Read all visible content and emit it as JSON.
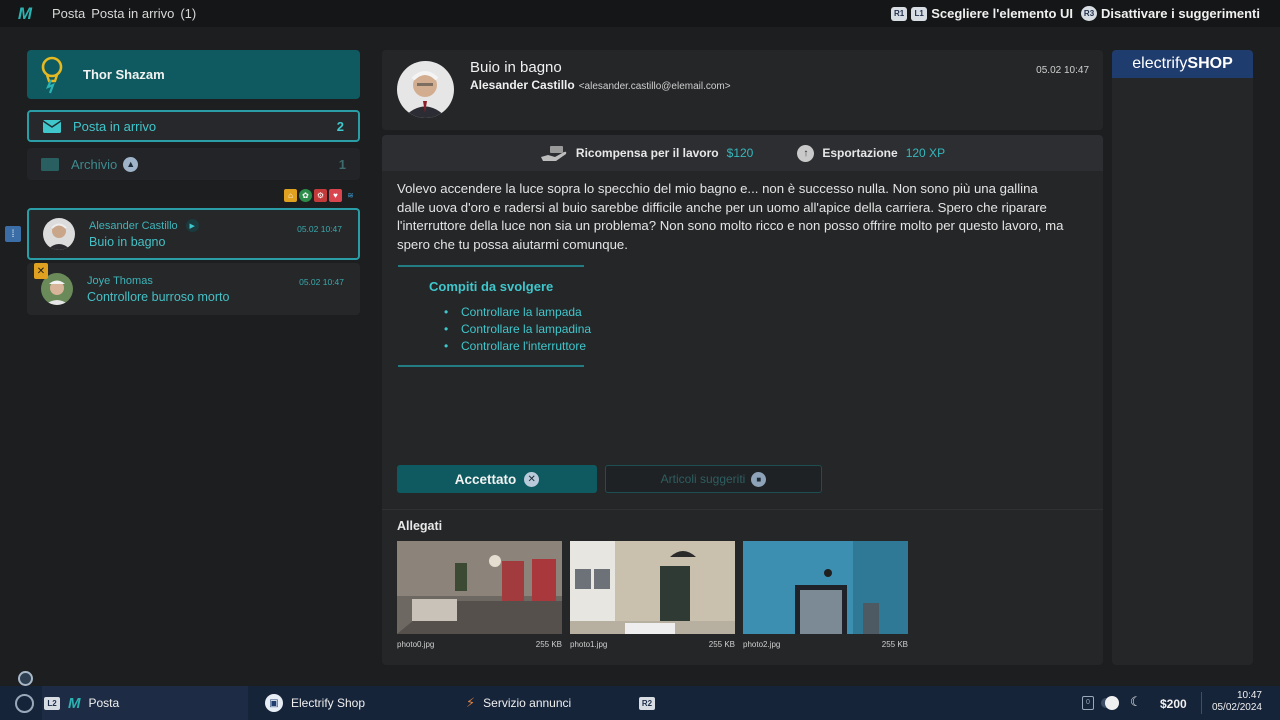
{
  "topbar": {
    "breadcrumb": [
      "Posta",
      "Posta in arrivo",
      "(1)"
    ],
    "hint_buttons": [
      "R1",
      "L1"
    ],
    "hint_select": "Scegliere l'elemento UI",
    "hint_r3": "R3",
    "hint_disable": "Disattivare i suggerimenti"
  },
  "sidebar": {
    "profile_name": "Thor Shazam",
    "folders": [
      {
        "label": "Posta in arrivo",
        "count": "2",
        "icon": "mail-icon"
      },
      {
        "label": "Archivio",
        "count": "1",
        "icon": "archive-icon"
      }
    ],
    "status_icons": [
      "home-icon",
      "gear-icon",
      "settings-icon",
      "heart-icon",
      "wifi-icon"
    ],
    "messages": [
      {
        "sender": "Alesander Castillo",
        "subject": "Buio in bagno",
        "time": "05.02 10:47"
      },
      {
        "sender": "Joye Thomas",
        "subject": "Controllore burroso morto",
        "time": "05.02 10:47"
      }
    ]
  },
  "mail": {
    "subject": "Buio in bagno",
    "sender_name": "Alesander Castillo",
    "sender_email": "<alesander.castillo@elemail.com>",
    "date": "05.02 10:47",
    "reward_label": "Ricompensa per il lavoro",
    "reward_value": "$120",
    "export_label": "Esportazione",
    "export_value": "120 XP",
    "body": "Volevo accendere la luce sopra lo specchio del mio bagno e... non è successo nulla. Non sono più una gallina dalle uova d'oro e radersi al buio sarebbe difficile anche per un uomo all'apice della carriera. Spero che riparare l'interruttore della luce non sia un problema? Non sono molto ricco e non posso offrire molto per questo lavoro, ma spero che tu possa aiutarmi comunque.",
    "tasks_title": "Compiti da svolgere",
    "tasks": [
      "Controllare la lampada",
      "Controllare la lampadina",
      "Controllare l'interruttore"
    ],
    "accept_label": "Accettato",
    "articles_label": "Articoli suggeriti",
    "attachments_title": "Allegati",
    "attachments": [
      {
        "name": "photo0.jpg",
        "size": "255 KB"
      },
      {
        "name": "photo1.jpg",
        "size": "255 KB"
      },
      {
        "name": "photo2.jpg",
        "size": "255 KB"
      }
    ]
  },
  "ad": {
    "brand_light": "electrify",
    "brand_bold": "SHOP"
  },
  "taskbar": {
    "l2": "L2",
    "posta": "Posta",
    "shop": "Electrify Shop",
    "ads": "Servizio annunci",
    "r2": "R2",
    "money": "$200",
    "time": "10:47",
    "date": "05/02/2024"
  },
  "colors": {
    "accent": "#3fc7cc",
    "accent_dark": "#0f5a60",
    "taskbar": "#16243a",
    "brand": "#1f3c6e"
  }
}
